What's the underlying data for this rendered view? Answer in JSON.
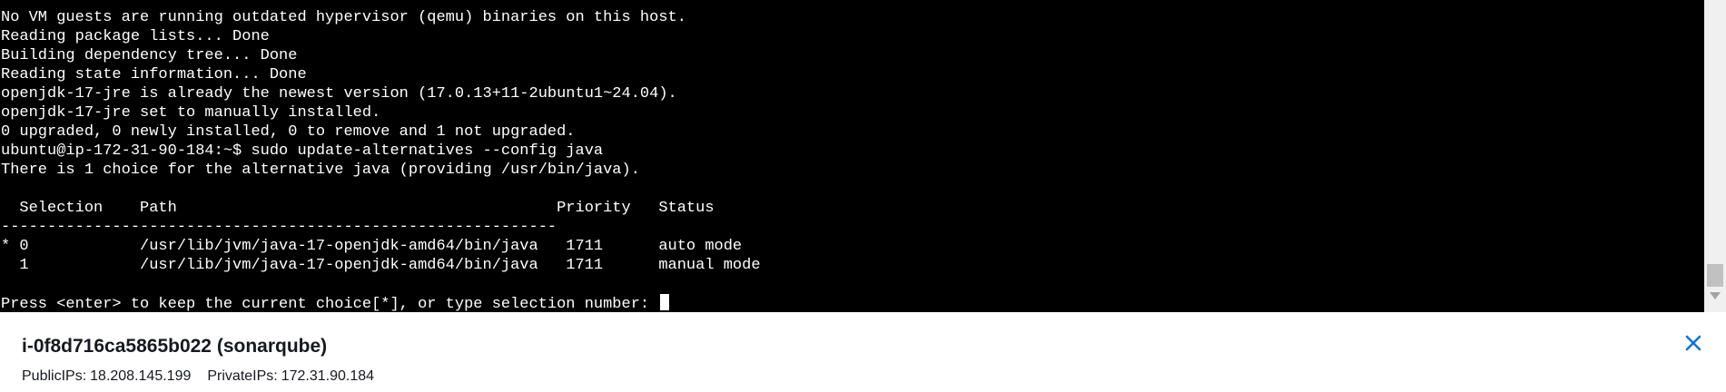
{
  "terminal": {
    "lines": [
      "No VM guests are running outdated hypervisor (qemu) binaries on this host.",
      "Reading package lists... Done",
      "Building dependency tree... Done",
      "Reading state information... Done",
      "openjdk-17-jre is already the newest version (17.0.13+11-2ubuntu1~24.04).",
      "openjdk-17-jre set to manually installed.",
      "0 upgraded, 0 newly installed, 0 to remove and 1 not upgraded.",
      "ubuntu@ip-172-31-90-184:~$ sudo update-alternatives --config java",
      "There is 1 choice for the alternative java (providing /usr/bin/java).",
      "",
      "  Selection    Path                                         Priority   Status",
      "------------------------------------------------------------",
      "* 0            /usr/lib/jvm/java-17-openjdk-amd64/bin/java   1711      auto mode",
      "  1            /usr/lib/jvm/java-17-openjdk-amd64/bin/java   1711      manual mode",
      "",
      "Press <enter> to keep the current choice[*], or type selection number: "
    ]
  },
  "instance": {
    "title": "i-0f8d716ca5865b022 (sonarqube)",
    "public_ip_label": "PublicIPs:",
    "public_ip": "18.208.145.199",
    "private_ip_label": "PrivateIPs:",
    "private_ip": "172.31.90.184"
  },
  "icons": {
    "close": "close-icon",
    "scroll_down": "scroll-down-arrow-icon"
  },
  "colors": {
    "terminal_bg": "#000000",
    "terminal_fg": "#ffffff",
    "close_icon": "#0972d3",
    "panel_text": "#16191f"
  }
}
